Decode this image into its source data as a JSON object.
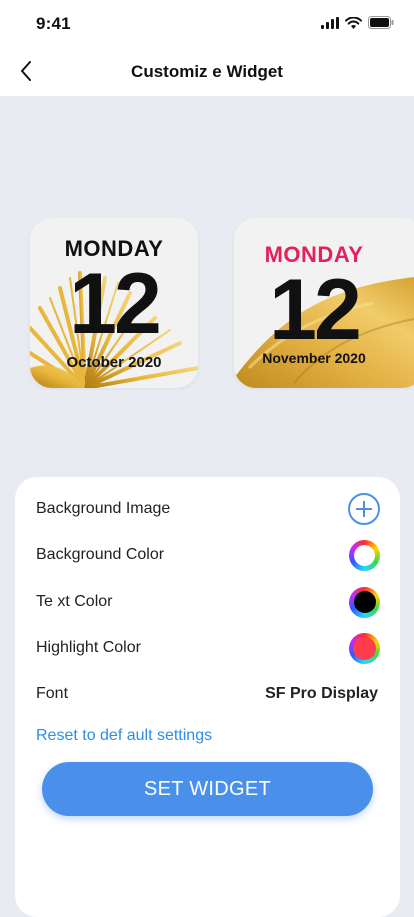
{
  "status_bar": {
    "time": "9:41"
  },
  "nav": {
    "title": "Customiz e Widget"
  },
  "widgets": [
    {
      "day": "MONDAY",
      "date": "12",
      "month": "October 2020",
      "day_color": "#111111"
    },
    {
      "day": "MONDAY",
      "date": "12",
      "month": "November 2020",
      "day_color": "#e4215b"
    }
  ],
  "settings": {
    "background_image": "Background Image",
    "background_color": "Background Color",
    "text_color": "Te xt Color",
    "highlight_color": "Highlight Color",
    "font_label": "Font",
    "font_value": "SF Pro Display"
  },
  "reset_label": "Reset to def ault settings",
  "cta_label": "SET WIDGET",
  "colors": {
    "accent": "#4a90ea",
    "link": "#2e8de6",
    "highlight": "#ff3b4e",
    "gold": "#d9a520",
    "background": "#e8ecf2"
  }
}
